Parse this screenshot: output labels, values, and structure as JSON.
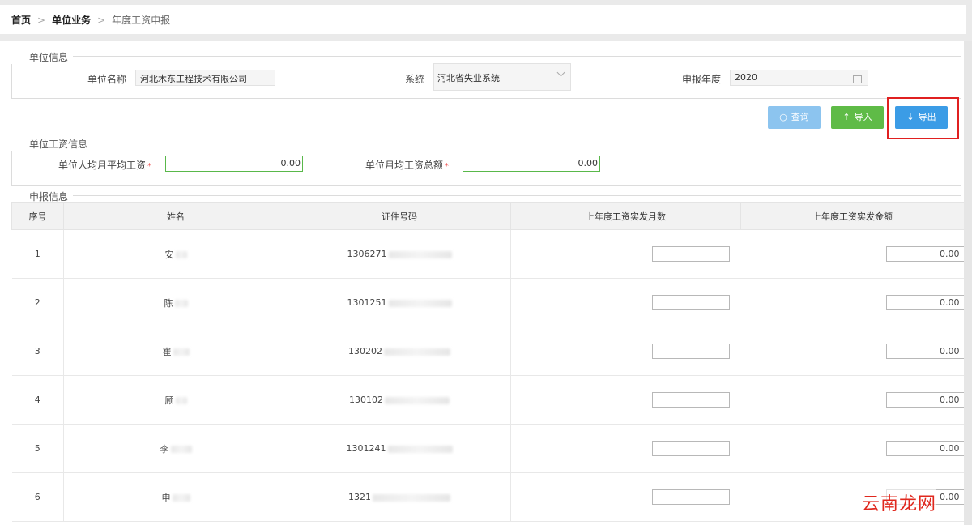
{
  "breadcrumb": {
    "home": "首页",
    "section": "单位业务",
    "current": "年度工资申报",
    "separator": ">"
  },
  "unit_info": {
    "title": "单位信息",
    "name_label": "单位名称",
    "name_value": "河北木东工程技术有限公司",
    "system_label": "系统",
    "system_value": "河北省失业系统",
    "year_label": "申报年度",
    "year_value": "2020"
  },
  "buttons": {
    "query": "查询",
    "import": "导入",
    "export": "导出"
  },
  "wage_info": {
    "title": "单位工资信息",
    "avg_label": "单位人均月平均工资",
    "avg_value": "0.00",
    "total_label": "单位月均工资总额",
    "total_value": "0.00"
  },
  "declare": {
    "title": "申报信息",
    "columns": [
      "序号",
      "姓名",
      "证件号码",
      "上年度工资实发月数",
      "上年度工资实发金额"
    ],
    "rows": [
      {
        "no": "1",
        "name": "安",
        "id": "1306271",
        "amount": "0.00"
      },
      {
        "no": "2",
        "name": "陈",
        "id": "1301251",
        "amount": "0.00"
      },
      {
        "no": "3",
        "name": "崔",
        "id": "130202",
        "amount": "0.00"
      },
      {
        "no": "4",
        "name": "顾",
        "id": "130102",
        "amount": "0.00"
      },
      {
        "no": "5",
        "name": "李",
        "id": "1301241",
        "amount": "0.00"
      },
      {
        "no": "6",
        "name": "申",
        "id": "1321",
        "amount": "0.00"
      }
    ]
  },
  "watermark": "云南龙网",
  "colors": {
    "query_btn": "#8cc4ef",
    "import_btn": "#5fbb47",
    "export_btn": "#3b9ce6",
    "highlight": "#e02020"
  }
}
